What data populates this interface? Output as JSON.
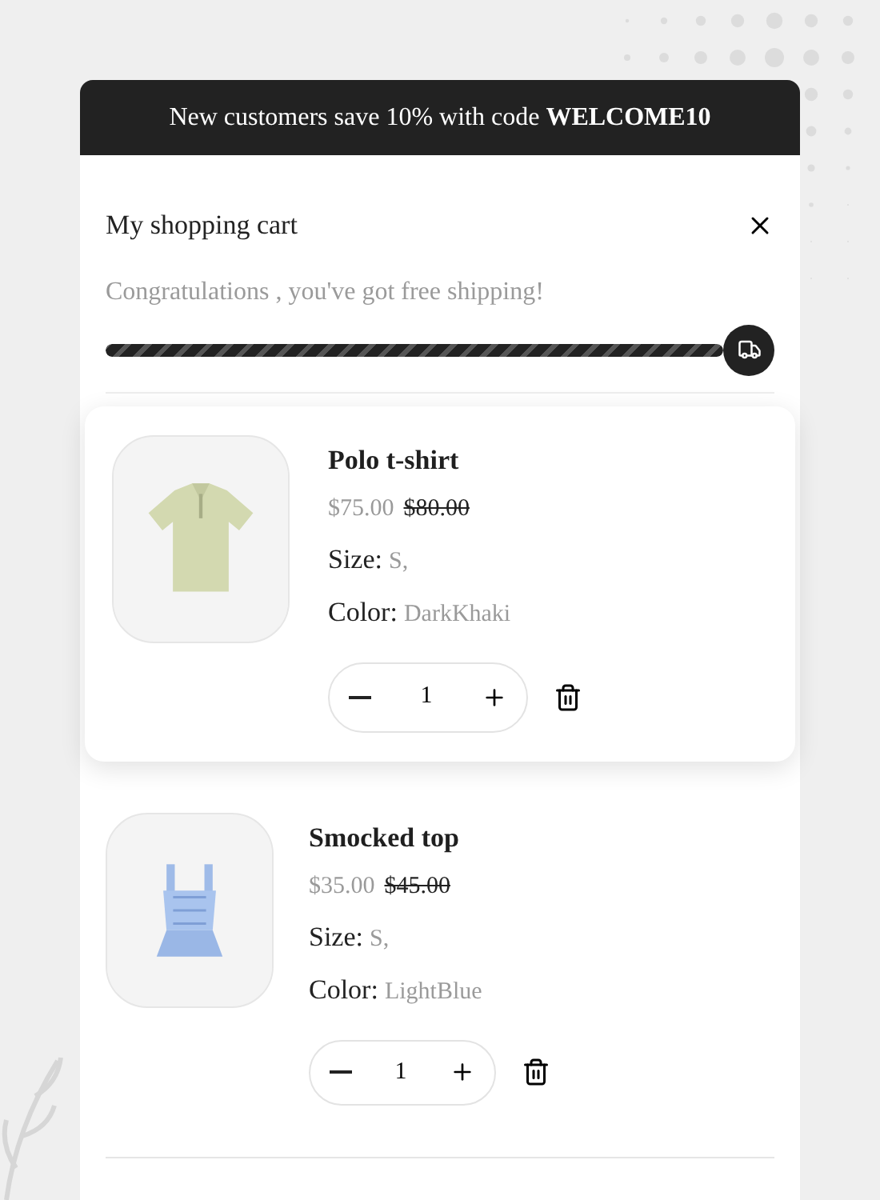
{
  "banner": "New customers save 10% with code **WELCOME10**",
  "cart": {
    "title": "My shopping cart",
    "shipping_message": "Congratulations , you've got free shipping!",
    "shipping_progress": {
      "level": 1
    }
  },
  "items": [
    {
      "name": "Polo t-shirt",
      "price": "$75.00",
      "old_price": "$80.00",
      "size_label": "Size:",
      "size": "S,",
      "color_label": "Color:",
      "color_name": "DarkKhaki",
      "quantity": "1",
      "highlighted": true
    },
    {
      "name": "Smocked top",
      "price": "$35.00",
      "old_price": "$45.00",
      "size_label": "Size:",
      "size": "S,",
      "color_label": "Color:",
      "color_name": "LightBlue",
      "quantity": "1",
      "highlighted": false
    }
  ]
}
